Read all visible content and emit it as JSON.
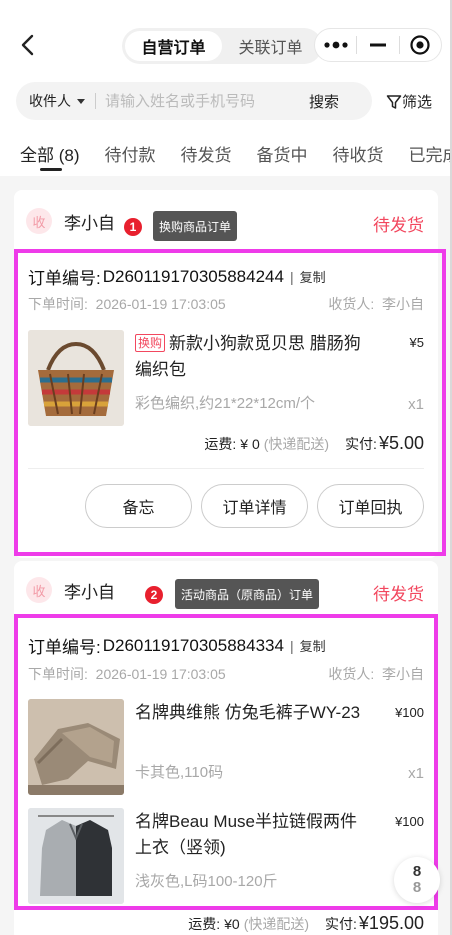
{
  "header": {
    "segments": [
      "自营订单",
      "关联订单"
    ]
  },
  "search": {
    "field_label": "收件人",
    "placeholder": "请输入姓名或手机号码",
    "button": "搜索",
    "filter": "筛选"
  },
  "tabs": [
    "全部 (8)",
    "待付款",
    "待发货",
    "备货中",
    "待收货",
    "已完成"
  ],
  "orders": [
    {
      "receiver_badge": "收",
      "receiver": "李小自",
      "status": "待发货",
      "badge_num": "1",
      "tip": "换购商品订单",
      "order_label": "订单编号:",
      "order_no": "D260119170305884244",
      "copy": "复制",
      "time_label": "下单时间:",
      "time": "2026-01-19 17:03:05",
      "consignee_label": "收货人:",
      "consignee": "李小自",
      "items": [
        {
          "tag": "换购",
          "title": "新款小狗款觅贝思 腊肠狗编织包",
          "spec": "彩色编织,约21*22*12cm/个",
          "price": "¥5",
          "qty": "x1"
        }
      ],
      "freight_label": "运费:",
      "freight": "¥ 0",
      "delivery": "(快递配送)",
      "paid_label": "实付:",
      "paid": "¥5.00",
      "actions": [
        "备忘",
        "订单详情",
        "订单回执"
      ]
    },
    {
      "receiver_badge": "收",
      "receiver": "李小自",
      "status": "待发货",
      "badge_num": "2",
      "tip": "活动商品（原商品）订单",
      "order_label": "订单编号:",
      "order_no": "D260119170305884334",
      "copy": "复制",
      "time_label": "下单时间:",
      "time": "2026-01-19 17:03:05",
      "consignee_label": "收货人:",
      "consignee": "李小自",
      "items": [
        {
          "title": "名牌典维熊 仿兔毛裤子WY-23",
          "spec": "卡其色,110码",
          "price": "¥100",
          "qty": "x1"
        },
        {
          "title": "名牌Beau Muse半拉链假两件上衣（竖领)",
          "spec": "浅灰色,L码100-120斤",
          "price": "¥100"
        }
      ],
      "freight_label": "运费:",
      "freight": "¥0",
      "delivery": "(快递配送)",
      "paid_label": "实付:",
      "paid": "¥195.00"
    }
  ],
  "pager": {
    "current": "8",
    "total": "8"
  },
  "colors": {
    "accent": "#f2475e",
    "highlight": "#ee3be9",
    "badge": "#e8202e"
  }
}
